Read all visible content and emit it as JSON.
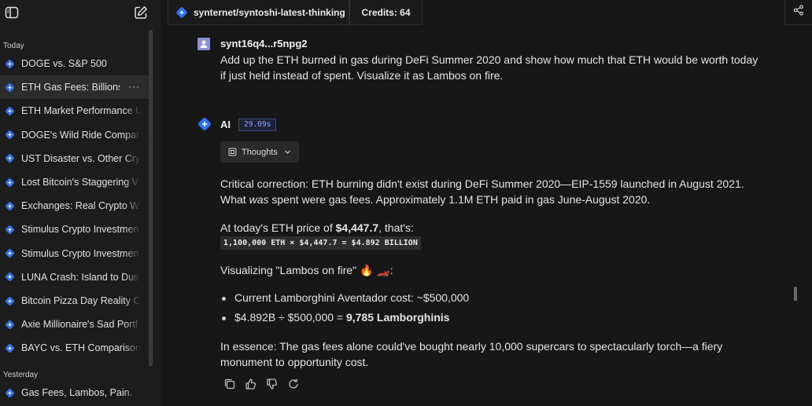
{
  "sidebar": {
    "sections": {
      "today": "Today",
      "yesterday": "Yesterday"
    },
    "today_items": [
      {
        "label": "DOGE vs. S&P 500"
      },
      {
        "label": "ETH Gas Fees: Billions",
        "active": true
      },
      {
        "label": "ETH Market Performance U"
      },
      {
        "label": "DOGE's Wild Ride Compari"
      },
      {
        "label": "UST Disaster vs. Other Cry"
      },
      {
        "label": "Lost Bitcoin's Staggering V"
      },
      {
        "label": "Exchanges: Real Crypto Wi"
      },
      {
        "label": "Stimulus Crypto Investmen"
      },
      {
        "label": "Stimulus Crypto Investmen"
      },
      {
        "label": "LUNA Crash: Island to Dus"
      },
      {
        "label": "Bitcoin Pizza Day Reality C"
      },
      {
        "label": "Axie Millionaire's Sad Portf"
      },
      {
        "label": "BAYC vs. ETH Comparison"
      }
    ],
    "yesterday_items": [
      {
        "label": "Gas Fees, Lambos, Pain."
      }
    ],
    "more_label": "···"
  },
  "topbar": {
    "repo": "synternet/syntoshi-latest-thinking",
    "credits": "Credits: 64"
  },
  "user_message": {
    "name": "synt16q4...r5npg2",
    "text": "Add up the ETH burned in gas during DeFi Summer 2020 and show how much that ETH would be worth today if just held instead of spent. Visualize it as Lambos on fire."
  },
  "ai_message": {
    "name": "AI",
    "time": "29.09s",
    "thoughts_label": "Thoughts",
    "p1_a": "Critical correction: ETH burning didn't exist during DeFi Summer 2020—EIP-1559 launched in August 2021.",
    "p1_b_pre": "What ",
    "p1_b_em": "was",
    "p1_b_post": " spent were gas fees. Approximately 1.1M ETH paid in gas June-August 2020.",
    "p2_pre": "At today's ETH price of ",
    "p2_bold": "$4,447.7",
    "p2_post": ", that's:",
    "code": "1,100,000 ETH × $4,447.7 = $4.892 BILLION",
    "p3": "Visualizing \"Lambos on fire\" 🔥 🏎️:",
    "bullet1": "Current Lamborghini Aventador cost: ~$500,000",
    "bullet2_pre": "$4.892B ÷ $500,000 = ",
    "bullet2_bold": "9,785 Lamborghinis",
    "p4_a": "In essence: The gas fees alone could've bought nearly 10,000 supercars to spectacularly torch—a fiery",
    "p4_b": "monument to opportunity cost."
  },
  "colors": {
    "brand": "#2f6fe8",
    "bg": "#171717",
    "sidebar": "#1c1c1c"
  }
}
